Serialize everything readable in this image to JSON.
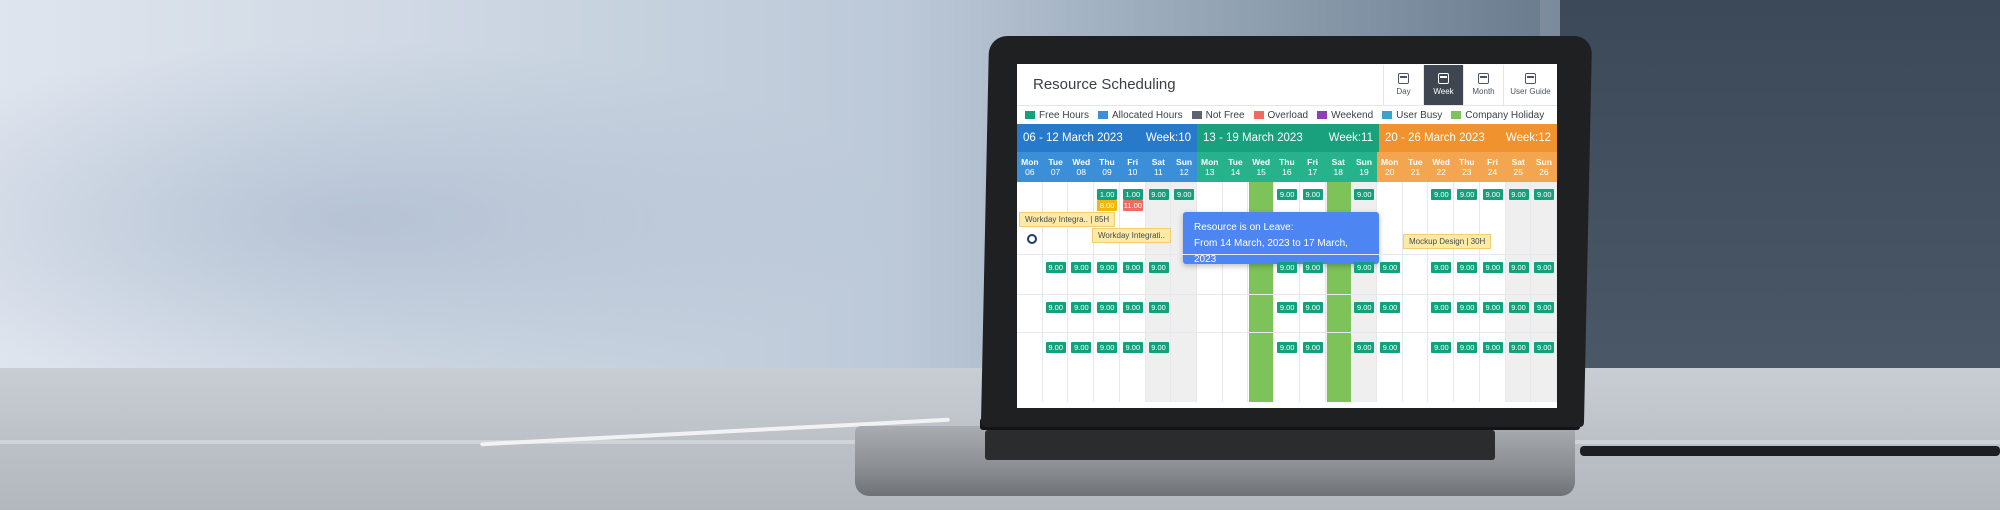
{
  "app": {
    "title": "Resource Scheduling"
  },
  "views": [
    {
      "label": "Day",
      "icon": "calendar-day-icon",
      "active": false
    },
    {
      "label": "Week",
      "icon": "calendar-week-icon",
      "active": true
    },
    {
      "label": "Month",
      "icon": "calendar-month-icon",
      "active": false
    },
    {
      "label": "User Guide",
      "icon": "user-guide-icon",
      "active": false
    }
  ],
  "legend": [
    {
      "label": "Free Hours",
      "color": "#13a07c"
    },
    {
      "label": "Allocated Hours",
      "color": "#3a8fd8"
    },
    {
      "label": "Not Free",
      "color": "#5b6470"
    },
    {
      "label": "Overload",
      "color": "#f06a5d"
    },
    {
      "label": "Weekend",
      "color": "#8e3fb5"
    },
    {
      "label": "User Busy",
      "color": "#3aa3c9"
    },
    {
      "label": "Company Holiday",
      "color": "#7dc35a"
    }
  ],
  "weeks": [
    {
      "range": "06 - 12 March 2023",
      "week": "Week:10",
      "color": "#2779c9"
    },
    {
      "range": "13 - 19 March 2023",
      "week": "Week:11",
      "color": "#18a17c"
    },
    {
      "range": "20 - 26 March 2023",
      "week": "Week:12",
      "color": "#f0932e"
    }
  ],
  "days": [
    {
      "name": "Mon",
      "num": "06"
    },
    {
      "name": "Tue",
      "num": "07"
    },
    {
      "name": "Wed",
      "num": "08"
    },
    {
      "name": "Thu",
      "num": "09"
    },
    {
      "name": "Fri",
      "num": "10"
    },
    {
      "name": "Sat",
      "num": "11"
    },
    {
      "name": "Sun",
      "num": "12"
    },
    {
      "name": "Mon",
      "num": "13"
    },
    {
      "name": "Tue",
      "num": "14"
    },
    {
      "name": "Wed",
      "num": "15"
    },
    {
      "name": "Thu",
      "num": "16"
    },
    {
      "name": "Fri",
      "num": "17"
    },
    {
      "name": "Sat",
      "num": "18"
    },
    {
      "name": "Sun",
      "num": "19"
    },
    {
      "name": "Mon",
      "num": "20"
    },
    {
      "name": "Tue",
      "num": "21"
    },
    {
      "name": "Wed",
      "num": "22"
    },
    {
      "name": "Thu",
      "num": "23"
    },
    {
      "name": "Fri",
      "num": "24"
    },
    {
      "name": "Sat",
      "num": "25"
    },
    {
      "name": "Sun",
      "num": "26"
    }
  ],
  "chips": {
    "row1": [
      {
        "day": 3,
        "value": "1.00",
        "kind": "free"
      },
      {
        "day": 3,
        "value": "8.00",
        "kind": "yellow",
        "sub": true
      },
      {
        "day": 4,
        "value": "1.00",
        "kind": "free"
      },
      {
        "day": 4,
        "value": "11.00",
        "kind": "red",
        "sub": true
      },
      {
        "day": 5,
        "value": "9.00",
        "kind": "free"
      },
      {
        "day": 6,
        "value": "9.00",
        "kind": "free"
      },
      {
        "day": 10,
        "value": "9.00",
        "kind": "free"
      },
      {
        "day": 11,
        "value": "9.00",
        "kind": "free"
      },
      {
        "day": 13,
        "value": "9.00",
        "kind": "free"
      },
      {
        "day": 16,
        "value": "9.00",
        "kind": "free"
      },
      {
        "day": 17,
        "value": "9.00",
        "kind": "free"
      },
      {
        "day": 18,
        "value": "9.00",
        "kind": "free"
      },
      {
        "day": 19,
        "value": "9.00",
        "kind": "free"
      },
      {
        "day": 20,
        "value": "9.00",
        "kind": "free"
      }
    ],
    "row2": [
      "9.00",
      "9.00",
      "9.00",
      "9.00",
      "9.00",
      "9.00",
      "9.00",
      "9.00",
      "9.00",
      "9.00",
      "9.00",
      "9.00",
      "9.00",
      "9.00"
    ],
    "row3": [
      "9.00",
      "9.00",
      "9.00",
      "9.00",
      "9.00",
      "9.00",
      "9.00",
      "9.00",
      "9.00",
      "9.00",
      "9.00",
      "9.00",
      "9.00",
      "9.00"
    ],
    "row4": [
      "9.00",
      "9.00",
      "9.00",
      "9.00",
      "9.00",
      "9.00",
      "9.00",
      "9.00",
      "9.00",
      "9.00",
      "9.00",
      "9.00",
      "9.00",
      "9.00"
    ]
  },
  "bars": [
    {
      "label": "Workday Integra..  |  85H"
    },
    {
      "label": "Workday Integrati.."
    },
    {
      "label": "Mockup Design  |  30H"
    }
  ],
  "tooltip": {
    "title": "Resource is on Leave:",
    "detail": "From 14 March, 2023 to 17 March, 2023"
  }
}
